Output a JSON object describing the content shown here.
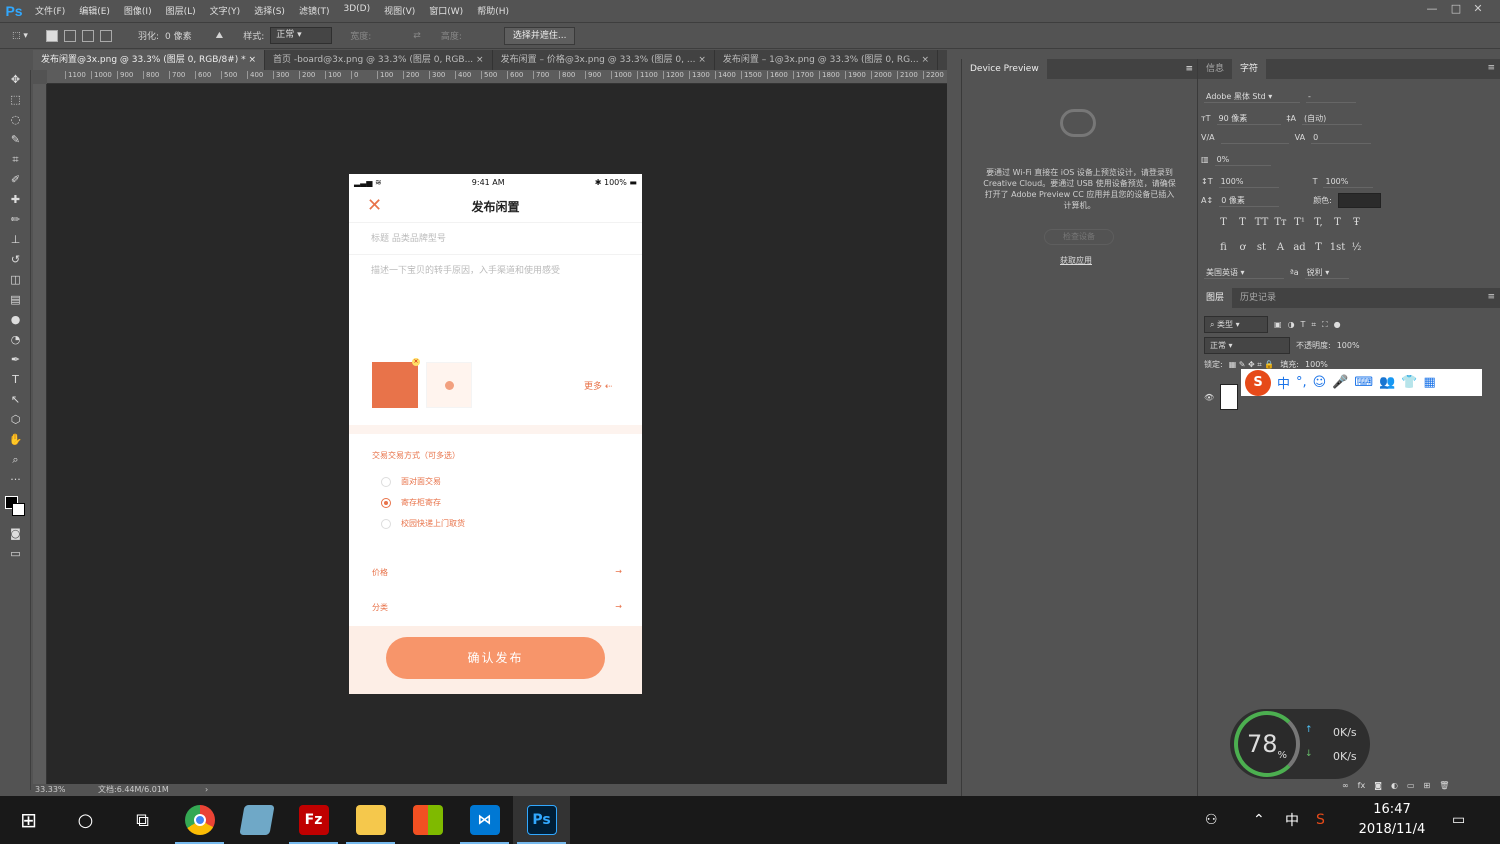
{
  "app": {
    "logo": "Ps"
  },
  "menu": [
    "文件(F)",
    "编辑(E)",
    "图像(I)",
    "图层(L)",
    "文字(Y)",
    "选择(S)",
    "滤镜(T)",
    "3D(D)",
    "视图(V)",
    "窗口(W)",
    "帮助(H)"
  ],
  "window_controls": [
    "—",
    "□",
    "✕"
  ],
  "options": {
    "feather_label": "羽化:",
    "feather_value": "0 像素",
    "style_label": "样式:",
    "style_value": "正常",
    "width_label": "宽度:",
    "height_label": "高度:",
    "mask_button": "选择并遮住..."
  },
  "tabs": [
    "发布闲置@3x.png @ 33.3% (图层 0, RGB/8#) *",
    "首页 -board@3x.png @ 33.3% (图层 0, RGB...",
    "发布闲置 – 价格@3x.png @ 33.3% (图层 0, ...",
    "发布闲置 – 1@3x.png @ 33.3% (图层 0, RG..."
  ],
  "ruler_ticks": [
    "1100",
    "1000",
    "900",
    "800",
    "700",
    "600",
    "500",
    "400",
    "300",
    "200",
    "100",
    "0",
    "100",
    "200",
    "300",
    "400",
    "500",
    "600",
    "700",
    "800",
    "900",
    "1000",
    "1100",
    "1200",
    "1300",
    "1400",
    "1500",
    "1600",
    "1700",
    "1800",
    "1900",
    "2000",
    "2100",
    "2200"
  ],
  "status": {
    "zoom": "33.33%",
    "doc": "文档:6.44M/6.01M"
  },
  "phone": {
    "time": "9:41 AM",
    "battery": "100%",
    "title": "发布闲置",
    "title_placeholder": "标题 品类品牌型号",
    "desc_placeholder": "描述一下宝贝的转手原因，入手渠道和使用感受",
    "more": "更多",
    "section_title": "交易交易方式（可多选）",
    "options": [
      "面对面交易",
      "寄存柜寄存",
      "校园快递上门取货"
    ],
    "rows": [
      "价格",
      "分类"
    ],
    "submit": "确认发布"
  },
  "device_preview": {
    "tab": "Device Preview",
    "message": "要通过 Wi-Fi 直接在 iOS 设备上预览设计，请登录到 Creative Cloud。要通过 USB 使用设备预览，请确保打开了 Adobe Preview CC 应用并且您的设备已插入计算机。",
    "button": "检查设备",
    "link": "获取应用"
  },
  "right_tabs": [
    "信息",
    "字符"
  ],
  "character": {
    "font": "Adobe 黑体 Std",
    "size": "90 像素",
    "leading": "(自动)",
    "tracking": "0",
    "scale_pct": "0%",
    "vscale": "100%",
    "hscale": "100%",
    "baseline": "0 像素",
    "color_label": "颜色:",
    "language": "美国英语",
    "aa_label": "ªa",
    "aa": "锐利",
    "style_glyphs": [
      "T",
      "T",
      "TT",
      "Tт",
      "T¹",
      "T,",
      "T",
      "Ŧ"
    ],
    "ot_glyphs": [
      "fi",
      "ơ",
      "st",
      "A",
      "ad",
      "T",
      "1st",
      "½"
    ]
  },
  "layers": {
    "tabs": [
      "图层",
      "历史记录"
    ],
    "kind": "类型",
    "blend": "正常",
    "opacity_label": "不透明度:",
    "opacity": "100%",
    "lock_label": "锁定:",
    "fill_label": "填充:",
    "fill": "100%"
  },
  "ime": {
    "items": [
      "S",
      "中",
      "°,",
      "☺",
      "🎤",
      "⌨",
      "👥",
      "👕",
      "▦"
    ]
  },
  "netmon": {
    "percent": "78",
    "unit": "%",
    "up": "0K/s",
    "down": "0K/s"
  },
  "taskbar": {
    "apps": [
      "⊞",
      "○",
      "⧉",
      "Chrome",
      "Edit",
      "Fz",
      "Folder",
      "Store",
      "VS",
      "Ps"
    ],
    "ime": "中",
    "time": "16:47",
    "date": "2018/11/4"
  }
}
